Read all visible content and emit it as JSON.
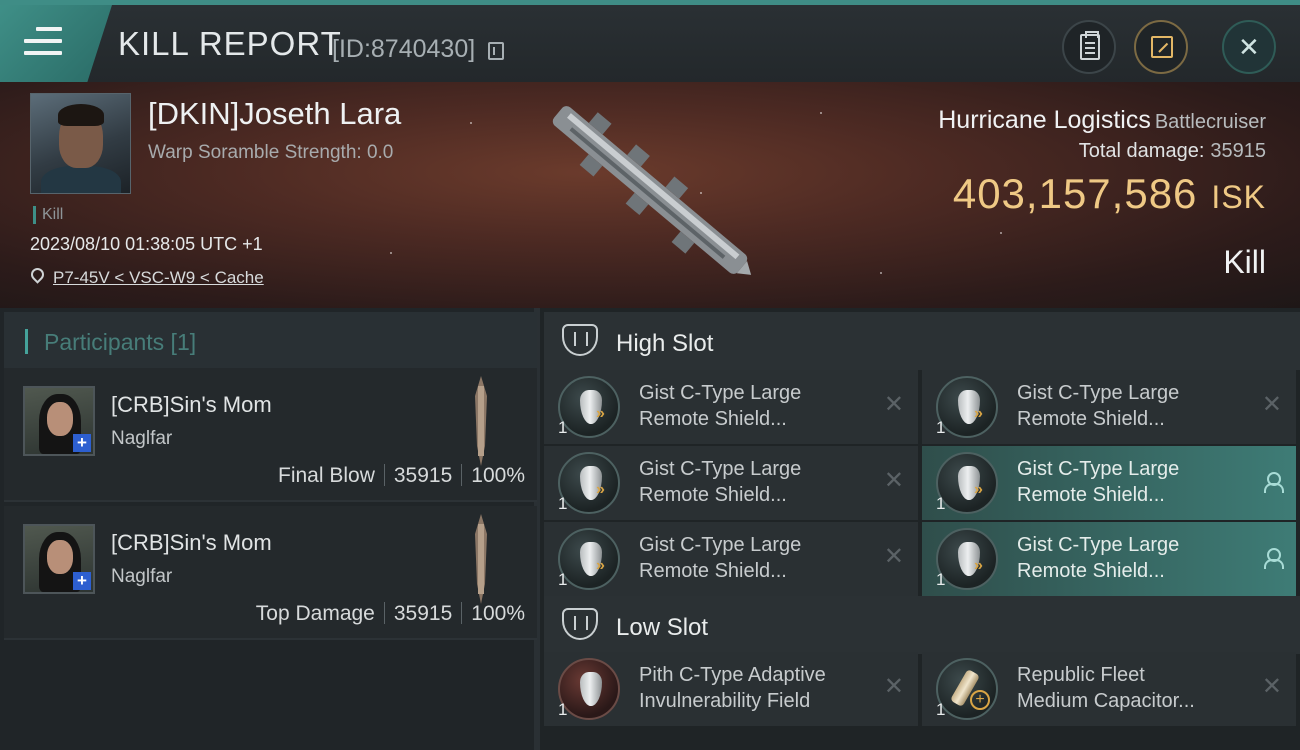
{
  "header": {
    "title": "KILL REPORT",
    "report_id": "[ID:8740430]"
  },
  "victim": {
    "name": "[DKIN]Joseth Lara",
    "scramble": "Warp Soramble Strength: 0.0",
    "kill_tag": "Kill",
    "datetime": "2023/08/10 01:38:05 UTC +1",
    "location": "P7-45V < VSC-W9 < Cache",
    "ship_name": "Hurricane Logistics",
    "ship_class": "Battlecruiser",
    "total_damage_label": "Total damage:",
    "total_damage_value": "35915",
    "isk_value": "403,157,586",
    "isk_unit": "ISK",
    "result": "Kill"
  },
  "participants": {
    "title": "Participants [1]",
    "items": [
      {
        "name": "[CRB]Sin's Mom",
        "ship": "Naglfar",
        "role": "Final Blow",
        "damage": "35915",
        "percent": "100%"
      },
      {
        "name": "[CRB]Sin's Mom",
        "ship": "Naglfar",
        "role": "Top Damage",
        "damage": "35915",
        "percent": "100%"
      }
    ]
  },
  "fitting": {
    "high_slot_title": "High Slot",
    "low_slot_title": "Low Slot",
    "high_modules": [
      {
        "line1": "Gist C-Type Large",
        "line2": "Remote Shield...",
        "qty": "1",
        "status": "destroyed"
      },
      {
        "line1": "Gist C-Type Large",
        "line2": "Remote Shield...",
        "qty": "1",
        "status": "destroyed"
      },
      {
        "line1": "Gist C-Type Large",
        "line2": "Remote Shield...",
        "qty": "1",
        "status": "destroyed"
      },
      {
        "line1": "Gist C-Type Large",
        "line2": "Remote Shield...",
        "qty": "1",
        "status": "dropped"
      },
      {
        "line1": "Gist C-Type Large",
        "line2": "Remote Shield...",
        "qty": "1",
        "status": "destroyed"
      },
      {
        "line1": "Gist C-Type Large",
        "line2": "Remote Shield...",
        "qty": "1",
        "status": "dropped"
      }
    ],
    "low_modules": [
      {
        "line1": "Pith C-Type Adaptive",
        "line2": "Invulnerability Field",
        "qty": "1",
        "status": "destroyed"
      },
      {
        "line1": "Republic Fleet",
        "line2": "Medium Capacitor...",
        "qty": "1",
        "status": "destroyed"
      }
    ]
  },
  "icons": {
    "menu": "hamburger-menu-icon",
    "copy": "copy-icon",
    "clipboard": "clipboard-icon",
    "share": "share-icon",
    "close": "close-icon",
    "location": "location-pin-icon",
    "destroyed": "x-icon",
    "dropped": "person-icon"
  },
  "colors": {
    "accent": "#3f8d86",
    "isk": "#efc985",
    "highlight_row": "#3e7c76"
  }
}
